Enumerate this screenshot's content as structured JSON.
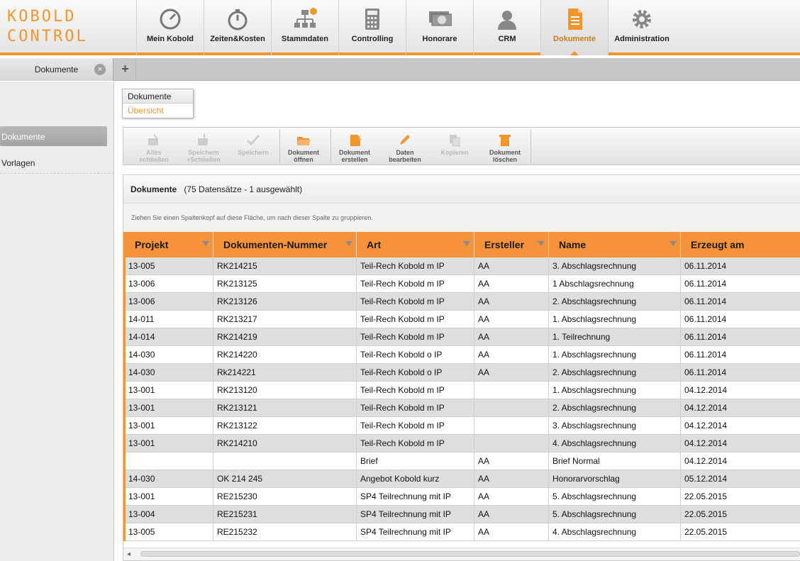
{
  "app": {
    "logo_line1": "KOBOLD",
    "logo_line2": "CONTROL",
    "accent_color": "#f0962c"
  },
  "nav": [
    {
      "label": "Mein Kobold",
      "icon": "gauge-icon"
    },
    {
      "label": "Zeiten&Kosten",
      "icon": "stopwatch-icon"
    },
    {
      "label": "Stammdaten",
      "icon": "org-chart-icon"
    },
    {
      "label": "Controlling",
      "icon": "calculator-icon"
    },
    {
      "label": "Honorare",
      "icon": "money-icon"
    },
    {
      "label": "CRM",
      "icon": "person-icon"
    },
    {
      "label": "Dokumente",
      "icon": "document-icon",
      "active": true
    },
    {
      "label": "Administration",
      "icon": "gear-icon"
    }
  ],
  "tabs": {
    "active_tab": "Dokumente",
    "close_icon": "close-icon",
    "add_icon": "plus-icon",
    "add_symbol": "+",
    "close_symbol": "×"
  },
  "sidebar": {
    "items": [
      {
        "label": "Dokumente",
        "active": true
      },
      {
        "label": "Vorlagen"
      }
    ]
  },
  "dropdown": {
    "header": "Dokumente",
    "item": "Übersicht"
  },
  "toolbar": {
    "buttons": [
      {
        "label1": "Alles",
        "label2": "schließen",
        "icon": "close-all-icon",
        "enabled": false
      },
      {
        "label1": "Speichern",
        "label2": "+Schließen",
        "icon": "save-close-icon",
        "enabled": false
      },
      {
        "label1": "Speichern",
        "label2": "",
        "icon": "checkmark-icon",
        "enabled": false
      },
      {
        "label1": "Dokument",
        "label2": "öffnen",
        "icon": "folder-open-icon",
        "enabled": true
      },
      {
        "label1": "Dokument",
        "label2": "erstellen",
        "icon": "new-document-icon",
        "enabled": true
      },
      {
        "label1": "Daten",
        "label2": "bearbeiten",
        "icon": "pencil-icon",
        "enabled": true
      },
      {
        "label1": "Kopieren",
        "label2": "",
        "icon": "copy-icon",
        "enabled": false
      },
      {
        "label1": "Dokument",
        "label2": "löschen",
        "icon": "trash-icon",
        "enabled": true
      }
    ]
  },
  "grid": {
    "title": "Dokumente",
    "summary": "(75 Datensätze -  1 ausgewählt)",
    "group_hint": "Ziehen Sie einen Spaltenkopf auf diese Fläche, um nach dieser Spalte zu gruppieren.",
    "columns": [
      "Projekt",
      "Dokumenten-Nummer",
      "Art",
      "Ersteller",
      "Name",
      "Erzeugt am"
    ],
    "rows": [
      [
        "13-005",
        "RK214215",
        "Teil-Rech Kobold m IP",
        "AA",
        "3. Abschlagsrechnung",
        "06.11.2014"
      ],
      [
        "13-006",
        "RK213125",
        "Teil-Rech Kobold m IP",
        "AA",
        "1 Abschlagsrechnung",
        "06.11.2014"
      ],
      [
        "13-006",
        "RK213126",
        "Teil-Rech Kobold m IP",
        "AA",
        "2. Abschlagsrechnung",
        "06.11.2014"
      ],
      [
        "14-011",
        "RK213217",
        "Teil-Rech Kobold m IP",
        "AA",
        "1. Abschlagsrechnung",
        "06.11.2014"
      ],
      [
        "14-014",
        "RK214219",
        "Teil-Rech Kobold m IP",
        "AA",
        "1. Teilrechnung",
        "06.11.2014"
      ],
      [
        "14-030",
        "RK214220",
        "Teil-Rech Kobold o IP",
        "AA",
        "1. Abschlagsrechnung",
        "06.11.2014"
      ],
      [
        "14-030",
        "Rk214221",
        "Teil-Rech Kobold o IP",
        "AA",
        "2. Abschlagsrechnung",
        "06.11.2014"
      ],
      [
        "13-001",
        "RK213120",
        "Teil-Rech Kobold m IP",
        "",
        "1. Abschlagsrechnung",
        "04.12.2014"
      ],
      [
        "13-001",
        "RK213121",
        "Teil-Rech Kobold m IP",
        "",
        "2. Abschlagsrechnung",
        "04.12.2014"
      ],
      [
        "13-001",
        "RK213122",
        "Teil-Rech Kobold m IP",
        "",
        "3. Abschlagsrechnung",
        "04.12.2014"
      ],
      [
        "13-001",
        "RK214210",
        "Teil-Rech Kobold m IP",
        "",
        "4. Abschlagsrechnung",
        "04.12.2014"
      ],
      [
        "",
        "",
        "Brief",
        "AA",
        "Brief Normal",
        "04.12.2014"
      ],
      [
        "14-030",
        "OK 214 245",
        "Angebot Kobold kurz",
        "AA",
        "Honorarvorschlag",
        "05.12.2014"
      ],
      [
        "13-001",
        "RE215230",
        "SP4 Teilrechnung mit IP",
        "AA",
        "5. Abschlagsrechnung",
        "22.05.2015"
      ],
      [
        "13-004",
        "RE215231",
        "SP4 Teilrechnung mit IP",
        "AA",
        "5. Abschlagsrechnung",
        "22.05.2015"
      ],
      [
        "13-005",
        "RE215232",
        "SP4 Teilrechnung mit IP",
        "AA",
        "4. Abschlagsrechnung",
        "22.05.2015"
      ]
    ]
  },
  "scrollbar": {
    "left_arrow": "◂"
  }
}
